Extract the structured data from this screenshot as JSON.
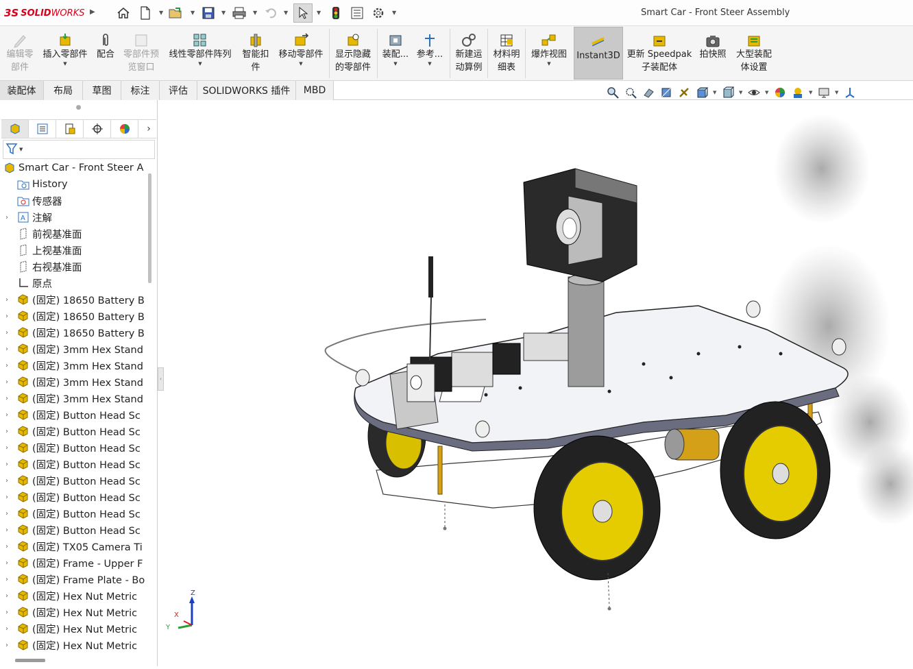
{
  "app": {
    "brand_ds": "3S",
    "brand_name": "SOLID",
    "brand_name2": "WORKS",
    "window_title": "Smart Car - Front Steer Assembly"
  },
  "quick_access": [
    {
      "name": "home-icon"
    },
    {
      "name": "new-document-icon"
    },
    {
      "name": "open-folder-icon"
    },
    {
      "name": "save-icon"
    },
    {
      "name": "print-icon"
    },
    {
      "name": "undo-icon"
    },
    {
      "name": "select-arrow-icon"
    },
    {
      "name": "rebuild-traffic-light-icon"
    },
    {
      "name": "file-properties-icon"
    },
    {
      "name": "options-gear-icon"
    }
  ],
  "ribbon": {
    "edit_component": {
      "l1": "编辑零",
      "l2": "部件"
    },
    "insert_component": {
      "l1": "插入零部件"
    },
    "mate": {
      "l1": "配合"
    },
    "component_preview": {
      "l1": "零部件预",
      "l2": "览窗口"
    },
    "linear_pattern": {
      "l1": "线性零部件阵列"
    },
    "smart_fasteners": {
      "l1": "智能扣",
      "l2": "件"
    },
    "move_component": {
      "l1": "移动零部件"
    },
    "show_hidden": {
      "l1": "显示隐藏",
      "l2": "的零部件"
    },
    "assembly_features": {
      "l1": "装配..."
    },
    "reference": {
      "l1": "参考..."
    },
    "new_motion": {
      "l1": "新建运",
      "l2": "动算例"
    },
    "bom": {
      "l1": "材料明",
      "l2": "细表"
    },
    "exploded_view": {
      "l1": "爆炸视图"
    },
    "instant3d": {
      "l1": "Instant3D"
    },
    "speedpak": {
      "l1": "更新 Speedpak",
      "l2": "子装配体"
    },
    "snapshot": {
      "l1": "拍快照"
    },
    "large_assembly": {
      "l1": "大型装配",
      "l2": "体设置"
    }
  },
  "tabs": [
    "装配体",
    "布局",
    "草图",
    "标注",
    "评估",
    "SOLIDWORKS 插件",
    "MBD"
  ],
  "tree": {
    "root": "Smart Car - Front Steer A",
    "items": [
      {
        "label": "History",
        "icon": "history-folder-icon",
        "expand": ""
      },
      {
        "label": "传感器",
        "icon": "sensors-folder-icon",
        "expand": ""
      },
      {
        "label": "注解",
        "icon": "annotations-icon",
        "expand": "›"
      },
      {
        "label": "前视基准面",
        "icon": "plane-icon",
        "expand": ""
      },
      {
        "label": "上视基准面",
        "icon": "plane-icon",
        "expand": ""
      },
      {
        "label": "右视基准面",
        "icon": "plane-icon",
        "expand": ""
      },
      {
        "label": "原点",
        "icon": "origin-icon",
        "expand": ""
      },
      {
        "label": "(固定) 18650 Battery B",
        "icon": "part-icon",
        "expand": "›"
      },
      {
        "label": "(固定) 18650 Battery B",
        "icon": "part-icon",
        "expand": "›"
      },
      {
        "label": "(固定) 18650 Battery B",
        "icon": "part-icon",
        "expand": "›"
      },
      {
        "label": "(固定) 3mm Hex Stand",
        "icon": "part-icon",
        "expand": "›"
      },
      {
        "label": "(固定) 3mm Hex Stand",
        "icon": "part-icon",
        "expand": "›"
      },
      {
        "label": "(固定) 3mm Hex Stand",
        "icon": "part-icon",
        "expand": "›"
      },
      {
        "label": "(固定) 3mm Hex Stand",
        "icon": "part-icon",
        "expand": "›"
      },
      {
        "label": "(固定) Button Head Sc",
        "icon": "part-icon",
        "expand": "›"
      },
      {
        "label": "(固定) Button Head Sc",
        "icon": "part-icon",
        "expand": "›"
      },
      {
        "label": "(固定) Button Head Sc",
        "icon": "part-icon",
        "expand": "›"
      },
      {
        "label": "(固定) Button Head Sc",
        "icon": "part-icon",
        "expand": "›"
      },
      {
        "label": "(固定) Button Head Sc",
        "icon": "part-icon",
        "expand": "›"
      },
      {
        "label": "(固定) Button Head Sc",
        "icon": "part-icon",
        "expand": "›"
      },
      {
        "label": "(固定) Button Head Sc",
        "icon": "part-icon",
        "expand": "›"
      },
      {
        "label": "(固定) Button Head Sc",
        "icon": "part-icon",
        "expand": "›"
      },
      {
        "label": "(固定) TX05 Camera Ti",
        "icon": "part-icon",
        "expand": "›"
      },
      {
        "label": "(固定) Frame - Upper F",
        "icon": "part-icon",
        "expand": "›"
      },
      {
        "label": "(固定) Frame Plate - Bo",
        "icon": "part-icon",
        "expand": "›"
      },
      {
        "label": "(固定) Hex Nut Metric",
        "icon": "part-icon",
        "expand": "›"
      },
      {
        "label": "(固定) Hex Nut Metric",
        "icon": "part-icon",
        "expand": "›"
      },
      {
        "label": "(固定) Hex Nut Metric",
        "icon": "part-icon",
        "expand": "›"
      },
      {
        "label": "(固定) Hex Nut Metric",
        "icon": "part-icon",
        "expand": "›"
      }
    ]
  },
  "triad": {
    "z": "Z",
    "x": "X",
    "y": "Y"
  },
  "colors": {
    "accent_red": "#d9001b",
    "part_yellow": "#e6b800",
    "ribbon_bg": "#f5f5f5"
  }
}
